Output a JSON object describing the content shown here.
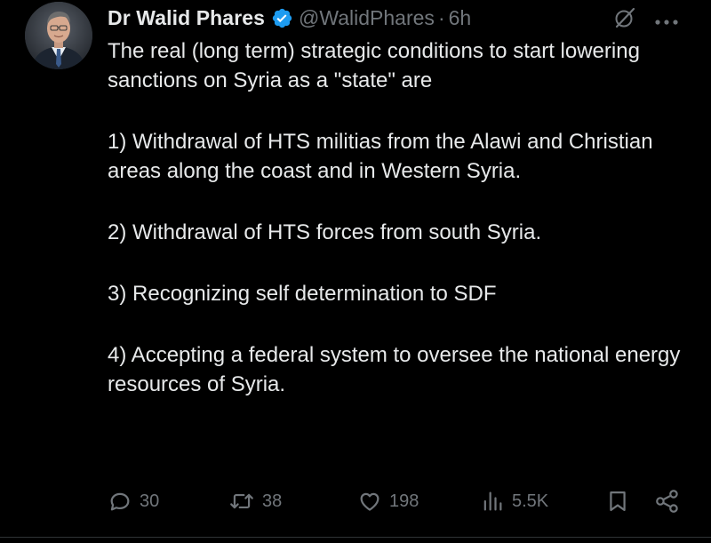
{
  "tweet": {
    "author": {
      "display_name": "Dr Walid Phares",
      "handle": "@WalidPhares",
      "verified": true
    },
    "separator": "·",
    "timestamp": "6h",
    "lines": [
      "The real (long term) strategic conditions to start lowering sanctions on Syria as a \"state\" are",
      "1) Withdrawal of HTS militias from the Alawi and Christian areas along the coast and in Western Syria.",
      "2) Withdrawal of HTS forces from south Syria.",
      "3) Recognizing self determination to SDF",
      "4) Accepting a federal system to oversee the national energy resources of Syria."
    ],
    "actions": {
      "replies": "30",
      "reposts": "38",
      "likes": "198",
      "views": "5.5K"
    }
  },
  "colors": {
    "background": "#000000",
    "text": "#e7e9ea",
    "muted": "#71767b",
    "verified_blue": "#1d9bf0"
  },
  "icons": {
    "avatar": "profile-photo",
    "verified": "verified-badge-icon",
    "grok": "grok-icon",
    "more": "more-dots-icon",
    "reply": "reply-bubble-icon",
    "repost": "repost-arrows-icon",
    "like": "heart-icon",
    "views": "bar-chart-icon",
    "bookmark": "bookmark-icon",
    "share": "share-icon"
  }
}
